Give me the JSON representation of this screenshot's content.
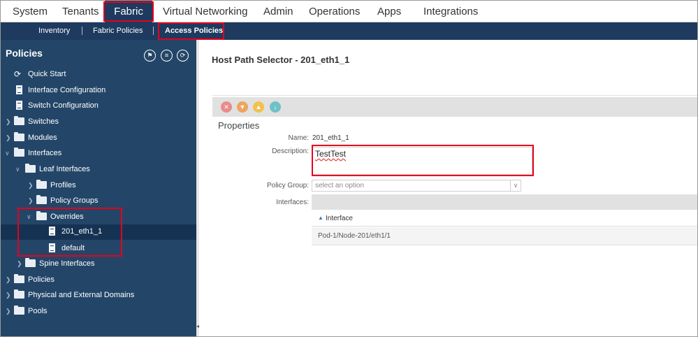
{
  "top_tabs": [
    "System",
    "Tenants",
    "Fabric",
    "Virtual Networking",
    "Admin",
    "Operations",
    "Apps",
    "Integrations"
  ],
  "sub_tabs": [
    "Inventory",
    "Fabric Policies",
    "Access Policies"
  ],
  "left_panel": {
    "title": "Policies",
    "tree": [
      {
        "label": "Quick Start",
        "icon": "quick-start-icon"
      },
      {
        "label": "Interface Configuration",
        "icon": "document-icon"
      },
      {
        "label": "Switch Configuration",
        "icon": "document-icon"
      },
      {
        "label": "Switches",
        "icon": "folder-icon"
      },
      {
        "label": "Modules",
        "icon": "folder-icon"
      },
      {
        "label": "Interfaces",
        "icon": "folder-icon"
      },
      {
        "label": "Leaf Interfaces",
        "icon": "folder-icon"
      },
      {
        "label": "Profiles",
        "icon": "folder-icon"
      },
      {
        "label": "Policy Groups",
        "icon": "folder-icon"
      },
      {
        "label": "Overrides",
        "icon": "folder-icon"
      },
      {
        "label": "201_eth1_1",
        "icon": "document-icon"
      },
      {
        "label": "default",
        "icon": "document-icon"
      },
      {
        "label": "Spine Interfaces",
        "icon": "folder-icon"
      },
      {
        "label": "Policies",
        "icon": "folder-icon"
      },
      {
        "label": "Physical and External Domains",
        "icon": "folder-icon"
      },
      {
        "label": "Pools",
        "icon": "folder-icon"
      }
    ]
  },
  "main": {
    "title": "Host Path Selector - 201_eth1_1",
    "section": "Properties",
    "name_label": "Name:",
    "name_value": "201_eth1_1",
    "description_label": "Description:",
    "description_value": "TestTest",
    "policy_group_label": "Policy Group:",
    "policy_group_placeholder": "select an option",
    "interfaces_label": "Interfaces:",
    "interfaces_column": "Interface",
    "interfaces_rows": [
      "Pod-1/Node-201/eth1/1"
    ]
  },
  "colors": {
    "nav_dark": "#1e3a5f",
    "sidebar": "#234668",
    "highlight_red": "#e8001c",
    "toolbar_delete": "#e98b8b",
    "toolbar_filter": "#f0a35e",
    "toolbar_warning": "#f2c14e",
    "toolbar_info": "#6fc1c8"
  }
}
